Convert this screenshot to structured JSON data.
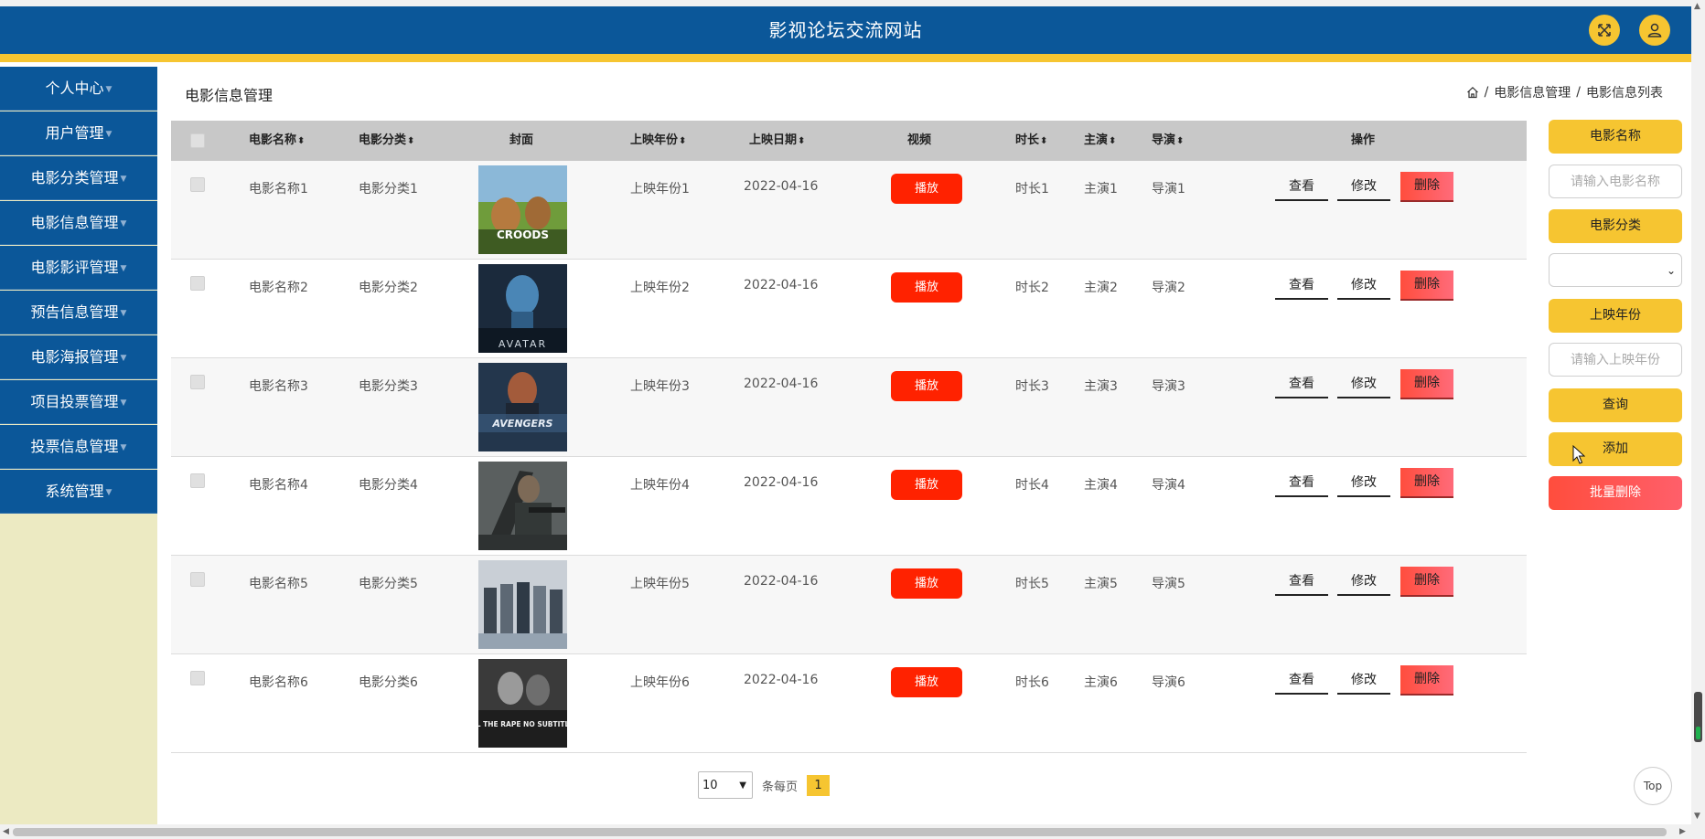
{
  "header": {
    "title": "影视论坛交流网站"
  },
  "sidebar": {
    "items": [
      {
        "label": "个人中心"
      },
      {
        "label": "用户管理"
      },
      {
        "label": "电影分类管理"
      },
      {
        "label": "电影信息管理"
      },
      {
        "label": "电影影评管理"
      },
      {
        "label": "预告信息管理"
      },
      {
        "label": "电影海报管理"
      },
      {
        "label": "项目投票管理"
      },
      {
        "label": "投票信息管理"
      },
      {
        "label": "系统管理"
      }
    ]
  },
  "page": {
    "title": "电影信息管理",
    "breadcrumb": [
      "电影信息管理",
      "电影信息列表"
    ]
  },
  "table": {
    "headers": {
      "name": "电影名称",
      "category": "电影分类",
      "cover": "封面",
      "year": "上映年份",
      "date": "上映日期",
      "video": "视频",
      "duration": "时长",
      "actor": "主演",
      "director": "导演",
      "ops": "操作"
    },
    "rows": [
      {
        "name": "电影名称1",
        "category": "电影分类1",
        "year": "上映年份1",
        "date": "2022-04-16",
        "duration": "时长1",
        "actor": "主演1",
        "director": "导演1",
        "poster": "CROODS"
      },
      {
        "name": "电影名称2",
        "category": "电影分类2",
        "year": "上映年份2",
        "date": "2022-04-16",
        "duration": "时长2",
        "actor": "主演2",
        "director": "导演2",
        "poster": "AVATAR"
      },
      {
        "name": "电影名称3",
        "category": "电影分类3",
        "year": "上映年份3",
        "date": "2022-04-16",
        "duration": "时长3",
        "actor": "主演3",
        "director": "导演3",
        "poster": "AVENGERS"
      },
      {
        "name": "电影名称4",
        "category": "电影分类4",
        "year": "上映年份4",
        "date": "2022-04-16",
        "duration": "时长4",
        "actor": "主演4",
        "director": "导演4",
        "poster": ""
      },
      {
        "name": "电影名称5",
        "category": "电影分类5",
        "year": "上映年份5",
        "date": "2022-04-16",
        "duration": "时长5",
        "actor": "主演5",
        "director": "导演5",
        "poster": ""
      },
      {
        "name": "电影名称6",
        "category": "电影分类6",
        "year": "上映年份6",
        "date": "2022-04-16",
        "duration": "时长6",
        "actor": "主演6",
        "director": "导演6",
        "poster": "ALL THE RAPE NO SUBTITLES"
      }
    ],
    "actions": {
      "play": "播放",
      "view": "查看",
      "edit": "修改",
      "delete": "删除"
    }
  },
  "search": {
    "name_label": "电影名称",
    "name_placeholder": "请输入电影名称",
    "category_label": "电影分类",
    "year_label": "上映年份",
    "year_placeholder": "请输入上映年份",
    "query": "查询",
    "add": "添加",
    "batch_delete": "批量删除"
  },
  "pagination": {
    "page_size": "10",
    "per_page_label": "条每页",
    "current_page": "1"
  },
  "top_button": "Top",
  "colors": {
    "primary": "#0b5799",
    "accent": "#f6c531",
    "danger": "#ff2200",
    "sidebar_bg": "#eceac2"
  }
}
